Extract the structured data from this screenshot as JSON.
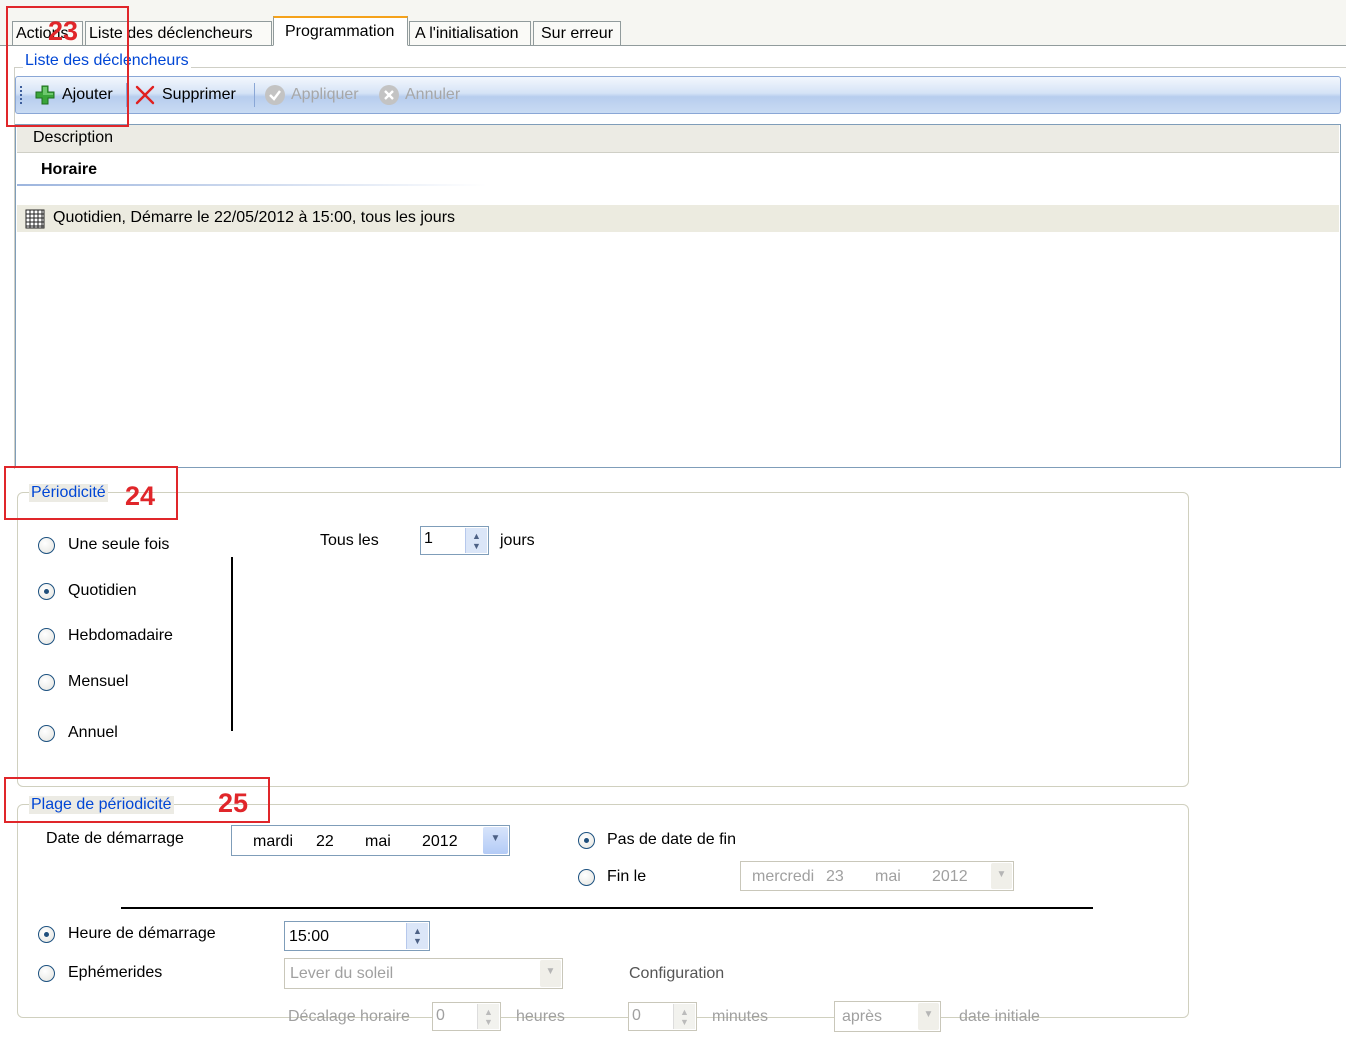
{
  "tabs": [
    {
      "label": "Actions"
    },
    {
      "label": "Liste des déclencheurs"
    },
    {
      "label": "Programmation",
      "active": true
    },
    {
      "label": "A l'initialisation"
    },
    {
      "label": "Sur erreur"
    }
  ],
  "triggers_group": {
    "legend": "Liste des déclencheurs",
    "toolbar": {
      "add_label": "Ajouter",
      "delete_label": "Supprimer",
      "apply_label": "Appliquer",
      "cancel_label": "Annuler"
    },
    "grid": {
      "column_header": "Description",
      "group_header": "Horaire",
      "rows": [
        "Quotidien, Démarre le 22/05/2012 à 15:00, tous les jours"
      ]
    }
  },
  "periodicity": {
    "legend": "Périodicité",
    "options": [
      "Une seule fois",
      "Quotidien",
      "Hebdomadaire",
      "Mensuel",
      "Annuel"
    ],
    "selected": "Quotidien",
    "every_label": "Tous les",
    "every_value": "1",
    "every_unit": "jours"
  },
  "range": {
    "legend": "Plage de périodicité",
    "start_date_label": "Date de démarrage",
    "start_date": {
      "weekday": "mardi",
      "day": "22",
      "month": "mai",
      "year": "2012"
    },
    "no_end_label": "Pas de date de fin",
    "end_on_label": "Fin le",
    "end_date": {
      "weekday": "mercredi",
      "day": "23",
      "month": "mai",
      "year": "2012"
    },
    "start_time_label": "Heure de démarrage",
    "start_time": "15:00",
    "ephemeris_label": "Ephémerides",
    "ephemeris_value": "Lever du soleil",
    "configuration_label": "Configuration",
    "offset_label": "Décalage horaire",
    "hours_value": "0",
    "hours_label": "heures",
    "minutes_value": "0",
    "minutes_label": "minutes",
    "relation_value": "après",
    "initial_date_label": "date initiale"
  },
  "annotations": [
    "23",
    "24",
    "25"
  ],
  "colors": {
    "annotation": "#e0262a",
    "legend": "#0046d5",
    "tab_active_top": "#f5a21b"
  }
}
